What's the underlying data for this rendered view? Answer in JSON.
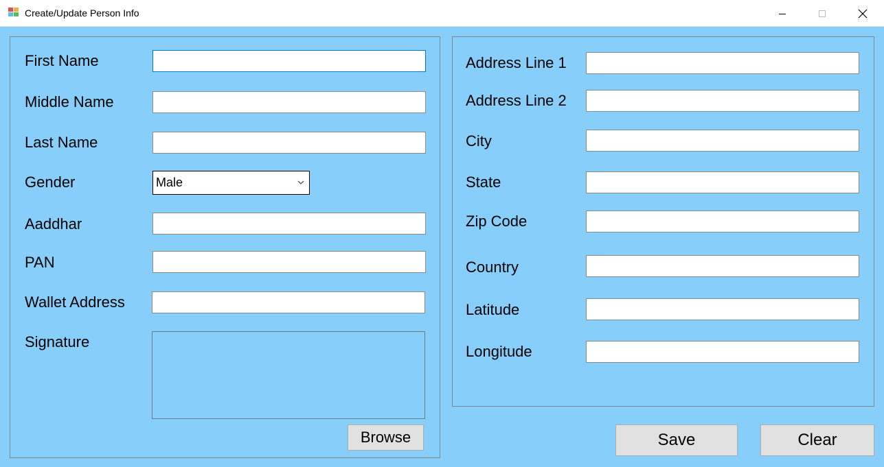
{
  "window": {
    "title": "Create/Update Person Info"
  },
  "icons": {
    "app": "app-form-icon",
    "minimize": "minimize-icon",
    "maximize": "maximize-icon",
    "close": "close-icon",
    "dropdown": "chevron-down-icon"
  },
  "colors": {
    "background": "#87cefa",
    "focus_border": "#0078d7",
    "button": "#e1e1e1"
  },
  "personal": {
    "first_name": {
      "label": "First Name",
      "value": ""
    },
    "middle_name": {
      "label": "Middle Name",
      "value": ""
    },
    "last_name": {
      "label": "Last Name",
      "value": ""
    },
    "gender": {
      "label": "Gender",
      "value": "Male"
    },
    "aadhar": {
      "label": "Aaddhar",
      "value": ""
    },
    "pan": {
      "label": "PAN",
      "value": ""
    },
    "wallet": {
      "label": "Wallet Address",
      "value": ""
    },
    "signature": {
      "label": "Signature"
    },
    "browse_label": "Browse"
  },
  "address": {
    "line1": {
      "label": "Address Line 1",
      "value": ""
    },
    "line2": {
      "label": "Address Line 2",
      "value": ""
    },
    "city": {
      "label": "City",
      "value": ""
    },
    "state": {
      "label": "State",
      "value": ""
    },
    "zip": {
      "label": "Zip Code",
      "value": ""
    },
    "country": {
      "label": "Country",
      "value": ""
    },
    "latitude": {
      "label": "Latitude",
      "value": ""
    },
    "longitude": {
      "label": "Longitude",
      "value": ""
    }
  },
  "actions": {
    "save_label": "Save",
    "clear_label": "Clear"
  }
}
